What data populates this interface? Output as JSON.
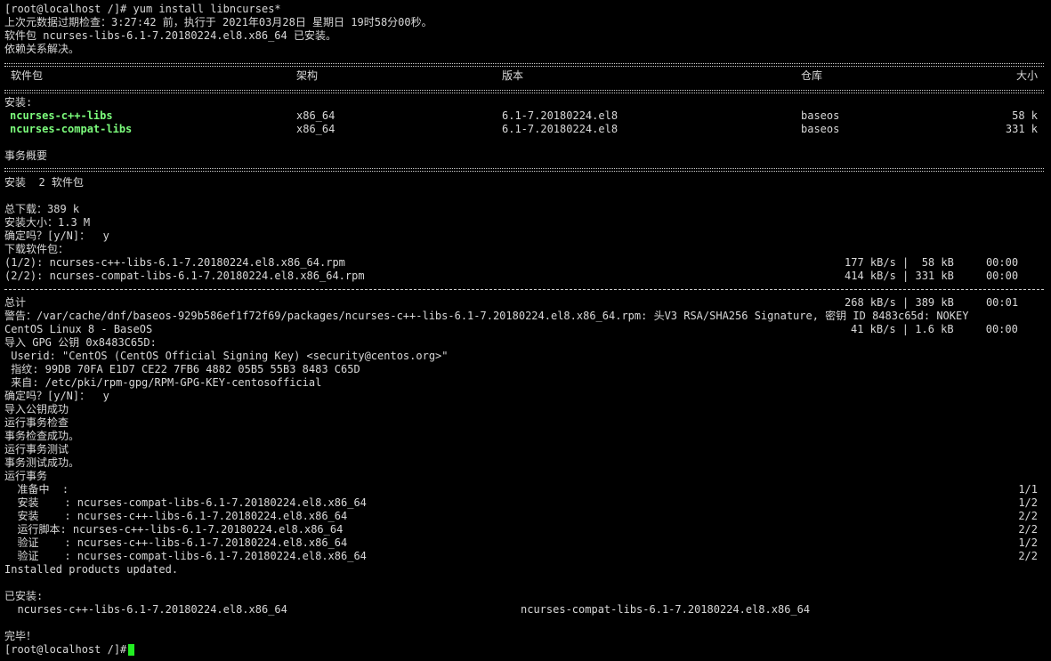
{
  "terminal": {
    "l01": "[root@localhost /]# yum install libncurses*",
    "l02": "上次元数据过期检查：3:27:42 前，执行于 2021年03月28日 星期日 19时58分00秒。",
    "l03": "软件包 ncurses-libs-6.1-7.20180224.el8.x86_64 已安装。",
    "l04": "依赖关系解决。",
    "table_headers": [
      "软件包",
      "架构",
      "版本",
      "仓库",
      "大小"
    ],
    "install_section": "安装:",
    "packages": [
      {
        "name": "ncurses-c++-libs",
        "arch": "x86_64",
        "version": "6.1-7.20180224.el8",
        "repo": "baseos",
        "size": "58 k"
      },
      {
        "name": "ncurses-compat-libs",
        "arch": "x86_64",
        "version": "6.1-7.20180224.el8",
        "repo": "baseos",
        "size": "331 k"
      }
    ],
    "summary_title": "事务概要",
    "install_count": "安装  2 软件包",
    "total_download": "总下载：389 k",
    "install_size": "安装大小：1.3 M",
    "confirm1": "确定吗？[y/N]：  y",
    "downloading": "下载软件包：",
    "downloads": [
      {
        "file": "(1/2): ncurses-c++-libs-6.1-7.20180224.el8.x86_64.rpm",
        "stats": "177 kB/s |  58 kB     00:00"
      },
      {
        "file": "(2/2): ncurses-compat-libs-6.1-7.20180224.el8.x86_64.rpm",
        "stats": "414 kB/s | 331 kB     00:00"
      }
    ],
    "total_label": "总计",
    "total_stats": "268 kB/s | 389 kB     00:01",
    "warning": "警告：/var/cache/dnf/baseos-929b586ef1f72f69/packages/ncurses-c++-libs-6.1-7.20180224.el8.x86_64.rpm: 头V3 RSA/SHA256 Signature, 密钥 ID 8483c65d: NOKEY",
    "centos_repo": "CentOS Linux 8 - BaseOS",
    "centos_stats": "41 kB/s | 1.6 kB     00:00",
    "gpg_import": "导入 GPG 公钥 0x8483C65D:",
    "userid": " Userid: \"CentOS (CentOS Official Signing Key) <security@centos.org>\"",
    "fingerprint": " 指纹: 99DB 70FA E1D7 CE22 7FB6 4882 05B5 55B3 8483 C65D",
    "from": " 来自: /etc/pki/rpm-gpg/RPM-GPG-KEY-centosofficial",
    "confirm2": "确定吗？[y/N]：  y",
    "key_imported": "导入公钥成功",
    "tx_check": "运行事务检查",
    "tx_check_ok": "事务检查成功。",
    "tx_test": "运行事务测试",
    "tx_test_ok": "事务测试成功。",
    "tx_run": "运行事务",
    "steps": [
      {
        "text": "  准备中  :",
        "count": "1/1"
      },
      {
        "text": "  安装    : ncurses-compat-libs-6.1-7.20180224.el8.x86_64",
        "count": "1/2"
      },
      {
        "text": "  安装    : ncurses-c++-libs-6.1-7.20180224.el8.x86_64",
        "count": "2/2"
      },
      {
        "text": "  运行脚本: ncurses-c++-libs-6.1-7.20180224.el8.x86_64",
        "count": "2/2"
      },
      {
        "text": "  验证    : ncurses-c++-libs-6.1-7.20180224.el8.x86_64",
        "count": "1/2"
      },
      {
        "text": "  验证    : ncurses-compat-libs-6.1-7.20180224.el8.x86_64",
        "count": "2/2"
      }
    ],
    "installed_products": "Installed products updated.",
    "installed_label": "已安装:",
    "installed": [
      "  ncurses-c++-libs-6.1-7.20180224.el8.x86_64",
      "ncurses-compat-libs-6.1-7.20180224.el8.x86_64"
    ],
    "done": "完毕！",
    "prompt": "[root@localhost /]# "
  },
  "colors": {
    "background": "#000000",
    "text": "#d8d8d8",
    "package_highlight": "#7cfc7c",
    "cursor": "#22ee22"
  }
}
